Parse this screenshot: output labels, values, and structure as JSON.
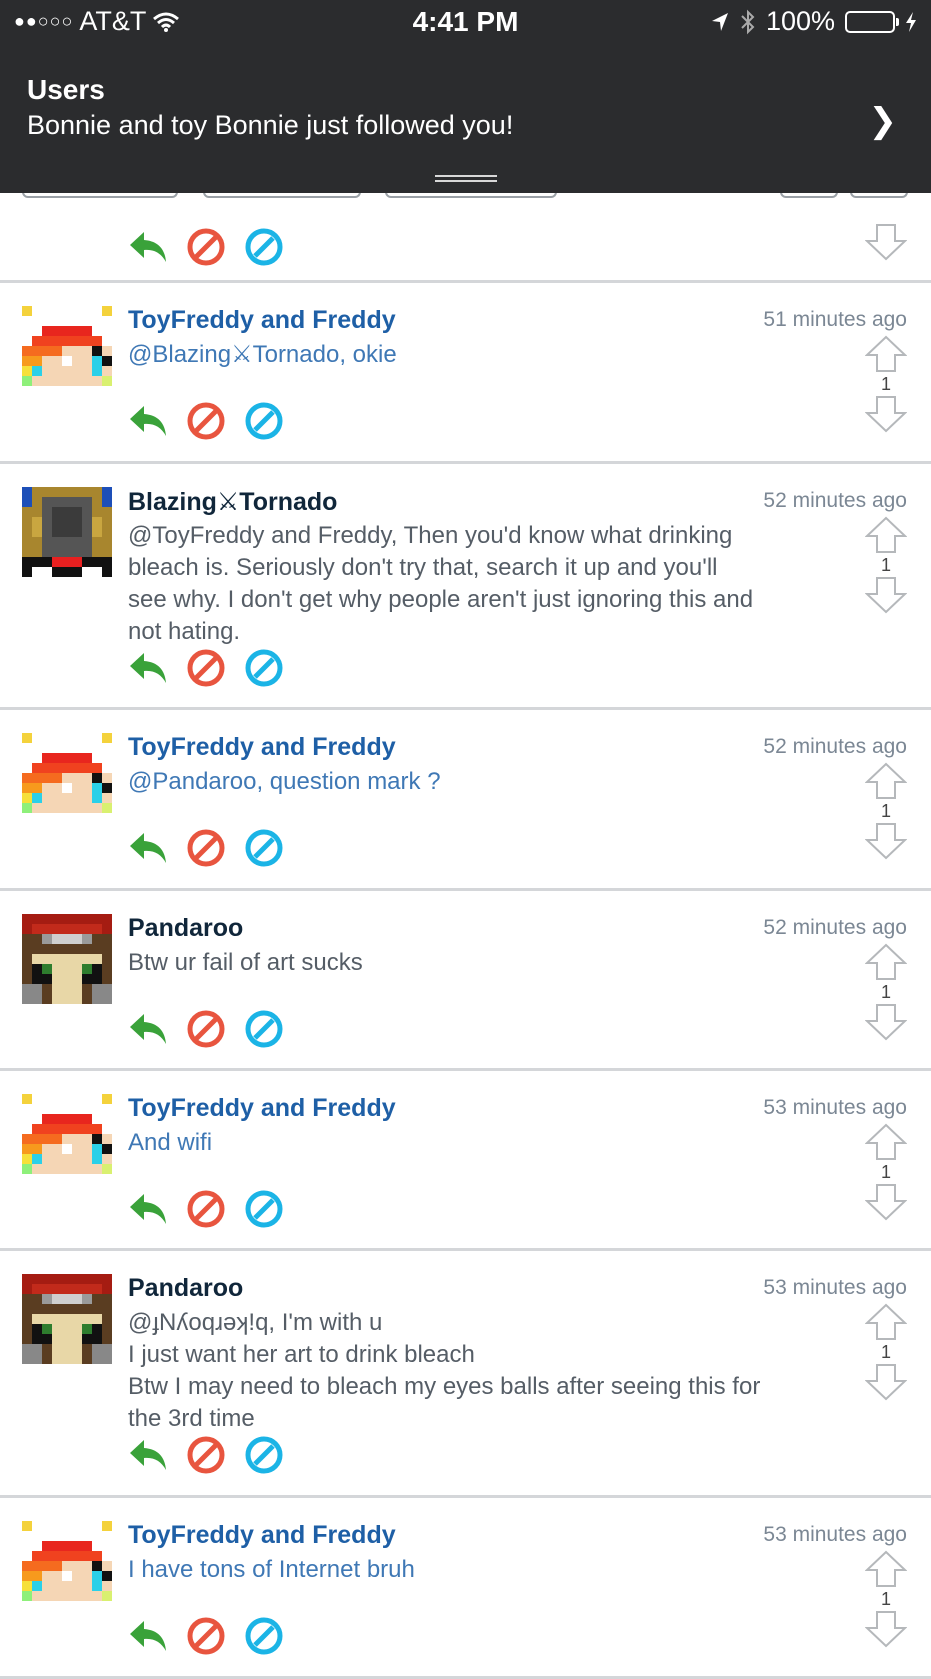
{
  "status_bar": {
    "carrier": "AT&T",
    "time": "4:41 PM",
    "battery": "100%"
  },
  "notification": {
    "title": "Users",
    "body": "Bonnie and toy Bonnie just followed you!"
  },
  "colors": {
    "reply": "#3aa23a",
    "flag": "#e8553f",
    "block": "#1bb4e6",
    "author_blue": "#1e5fa6"
  },
  "comments": [
    {
      "author": "ToyFreddy and Freddy",
      "time": "51 minutes ago",
      "text": [
        "@Blazing⚔Tornado, okie"
      ],
      "votes": "1"
    },
    {
      "author": "Blazing⚔Tornado",
      "time": "52 minutes ago",
      "text": [
        "@ToyFreddy and Freddy, Then you'd know what drinking",
        "bleach is. Seriously don't try that, search it up and you'll",
        "see why. I don't get why people aren't just ignoring this and",
        "not hating."
      ],
      "votes": "1"
    },
    {
      "author": "ToyFreddy and Freddy",
      "time": "52 minutes ago",
      "text": [
        "@Pandaroo, question mark ?"
      ],
      "votes": "1"
    },
    {
      "author": "Pandaroo",
      "time": "52 minutes ago",
      "text": [
        "Btw ur fail of art sucks"
      ],
      "votes": "1"
    },
    {
      "author": "ToyFreddy and Freddy",
      "time": "53 minutes ago",
      "text": [
        "And wifi"
      ],
      "votes": "1"
    },
    {
      "author": "Pandaroo",
      "time": "53 minutes ago",
      "text": [
        "@ɟNʎoqɹəʞ!q, I'm with u",
        "I just want her art to drink bleach",
        "Btw I may need to bleach my eyes balls after seeing this for",
        "the 3rd time"
      ],
      "votes": "1"
    },
    {
      "author": "ToyFreddy and Freddy",
      "time": "53 minutes ago",
      "text": [
        "I have tons of Internet bruh"
      ],
      "votes": "1"
    }
  ]
}
